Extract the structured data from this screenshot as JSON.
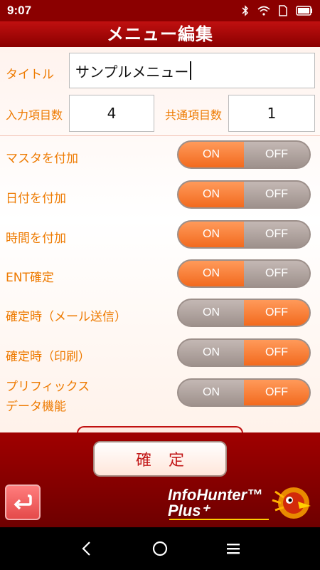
{
  "status": {
    "time": "9:07"
  },
  "header": {
    "title": "メニュー編集"
  },
  "form": {
    "title_label": "タイトル",
    "title_value": "サンプルメニュー",
    "input_items_label": "入力項目数",
    "input_items_value": "4",
    "common_items_label": "共通項目数",
    "common_items_value": "1"
  },
  "toggles": [
    {
      "label": "マスタを付加",
      "on": "ON",
      "off": "OFF",
      "state": "on"
    },
    {
      "label": "日付を付加",
      "on": "ON",
      "off": "OFF",
      "state": "on"
    },
    {
      "label": "時間を付加",
      "on": "ON",
      "off": "OFF",
      "state": "on"
    },
    {
      "label": "ENT確定",
      "on": "ON",
      "off": "OFF",
      "state": "on"
    },
    {
      "label": "確定時（メール送信）",
      "on": "ON",
      "off": "OFF",
      "state": "off"
    },
    {
      "label": "確定時（印刷）",
      "on": "ON",
      "off": "OFF",
      "state": "off"
    },
    {
      "label_line1": "プリフィックス",
      "label_line2": "データ機能",
      "on": "ON",
      "off": "OFF",
      "state": "off"
    }
  ],
  "footer": {
    "confirm_label": "確定",
    "logo_line1": "InfoHunter™",
    "logo_line2": "Plus⁺"
  },
  "icons": {
    "bluetooth": "bluetooth-icon",
    "wifi": "wifi-icon",
    "sim": "sim-icon",
    "battery": "battery-icon",
    "back": "return-arrow-icon",
    "nav_back": "chevron-left-icon",
    "nav_home": "home-circle-icon",
    "nav_menu": "menu-icon"
  },
  "colors": {
    "accent": "#ee7a00",
    "brand": "#8b0000",
    "toggle_active": "#f26a1e"
  }
}
